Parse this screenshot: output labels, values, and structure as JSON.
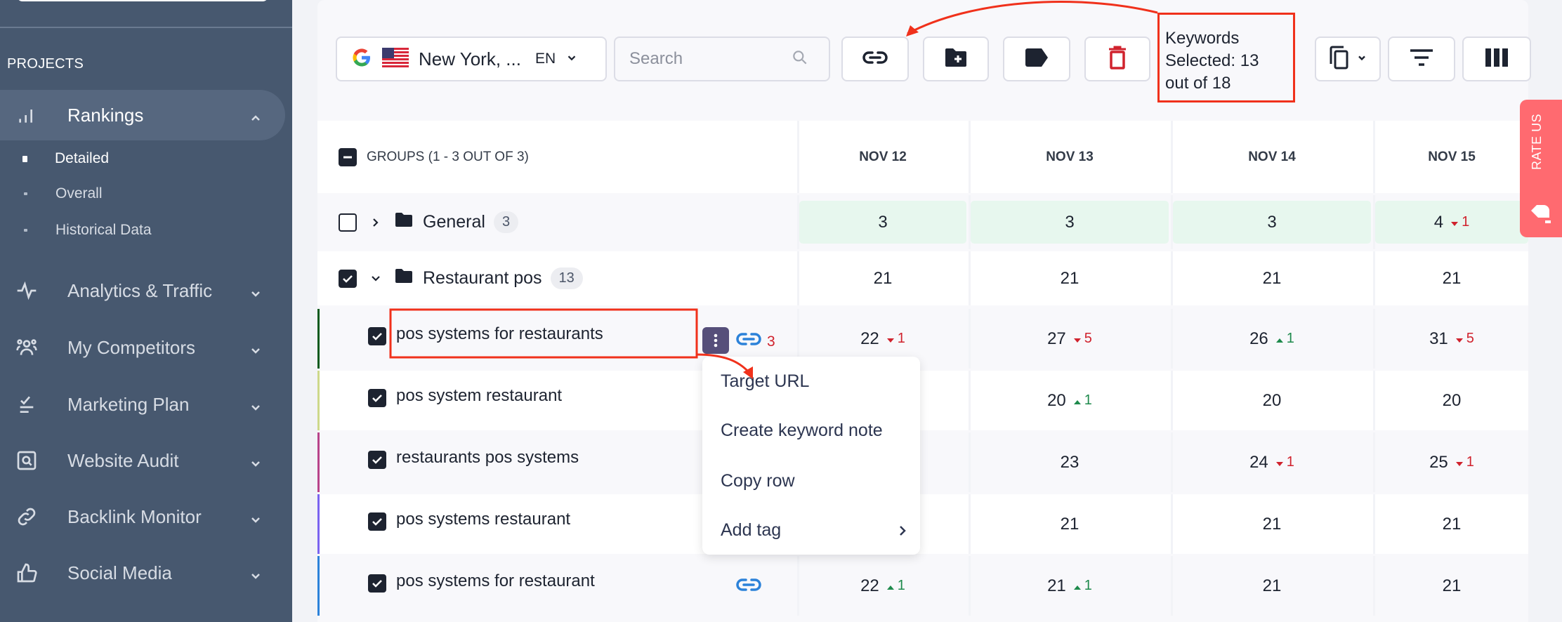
{
  "sidebar": {
    "section_label": "PROJECTS",
    "items": [
      {
        "label": "Rankings",
        "icon": "bar-chart-icon",
        "expanded": true,
        "children": [
          {
            "label": "Detailed",
            "active": true
          },
          {
            "label": "Overall",
            "active": false
          },
          {
            "label": "Historical Data",
            "active": false
          }
        ]
      },
      {
        "label": "Analytics & Traffic",
        "icon": "pulse-icon"
      },
      {
        "label": "My Competitors",
        "icon": "users-icon"
      },
      {
        "label": "Marketing Plan",
        "icon": "checklist-icon"
      },
      {
        "label": "Website Audit",
        "icon": "audit-search-icon"
      },
      {
        "label": "Backlink Monitor",
        "icon": "link-icon"
      },
      {
        "label": "Social Media",
        "icon": "thumbs-up-icon"
      }
    ]
  },
  "toolbar": {
    "location": "New York, ...",
    "language": "EN",
    "search_placeholder": "Search",
    "search_value": "",
    "buttons": [
      "target-url",
      "add-to-group",
      "tag",
      "delete",
      "copy",
      "filter",
      "columns"
    ]
  },
  "selection_annotation": "Keywords Selected: 13 out of 18",
  "table": {
    "header_label": "GROUPS (1 - 3 OUT OF 3)",
    "dates": [
      "NOV 12",
      "NOV 13",
      "NOV 14",
      "NOV 15"
    ],
    "groups": [
      {
        "name": "General",
        "count": "3",
        "checked": false,
        "expanded": false,
        "values": [
          {
            "v": "3"
          },
          {
            "v": "3"
          },
          {
            "v": "3"
          },
          {
            "v": "4",
            "chg": "1",
            "dir": "down"
          }
        ]
      },
      {
        "name": "Restaurant pos",
        "count": "13",
        "checked": true,
        "expanded": true,
        "values": [
          {
            "v": "21"
          },
          {
            "v": "21"
          },
          {
            "v": "21"
          },
          {
            "v": "21"
          }
        ]
      }
    ],
    "keywords": [
      {
        "name": "pos systems for restaurants",
        "checked": true,
        "stripe": "#0b5a1e",
        "link": true,
        "link_count": "3",
        "values": [
          {
            "v": "22",
            "chg": "1",
            "dir": "down"
          },
          {
            "v": "27",
            "chg": "5",
            "dir": "down"
          },
          {
            "v": "26",
            "chg": "1",
            "dir": "up"
          },
          {
            "v": "31",
            "chg": "5",
            "dir": "down"
          }
        ]
      },
      {
        "name": "pos system restaurant",
        "checked": true,
        "stripe": "#cdd88a",
        "link": false,
        "link_count": "",
        "values": [
          {
            "v": ""
          },
          {
            "v": "20",
            "chg": "1",
            "dir": "up"
          },
          {
            "v": "20"
          },
          {
            "v": "20"
          }
        ]
      },
      {
        "name": "restaurants pos systems",
        "checked": true,
        "stripe": "#b8438a",
        "link": false,
        "link_count": "",
        "values": [
          {
            "v": ""
          },
          {
            "v": "23"
          },
          {
            "v": "24",
            "chg": "1",
            "dir": "down"
          },
          {
            "v": "25",
            "chg": "1",
            "dir": "down"
          }
        ]
      },
      {
        "name": "pos systems restaurant",
        "checked": true,
        "stripe": "#7b63f0",
        "link": false,
        "link_count": "",
        "values": [
          {
            "v": ""
          },
          {
            "v": "21"
          },
          {
            "v": "21"
          },
          {
            "v": "21"
          }
        ]
      },
      {
        "name": "pos systems for restaurant",
        "checked": true,
        "stripe": "#2c82d9",
        "link": true,
        "link_count": "",
        "values": [
          {
            "v": "22",
            "chg": "1",
            "dir": "up"
          },
          {
            "v": "21",
            "chg": "1",
            "dir": "up"
          },
          {
            "v": "21"
          },
          {
            "v": "21"
          }
        ]
      }
    ]
  },
  "context_menu": {
    "items": [
      "Target URL",
      "Create keyword note",
      "Copy row",
      "Add tag"
    ]
  },
  "rate_us": "RATE US",
  "colors": {
    "accent_red": "#f0311b",
    "down": "#d0222d",
    "up": "#1e8a4c",
    "link_blue": "#2c82d9",
    "sidebar_bg": "#47586f"
  }
}
